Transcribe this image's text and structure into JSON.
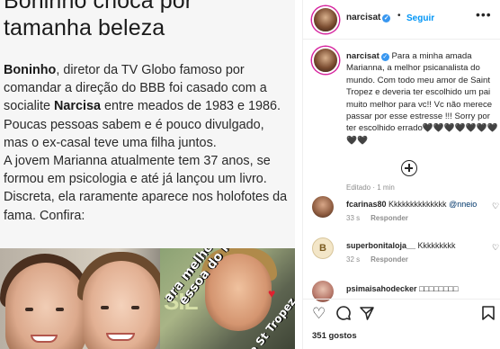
{
  "article": {
    "headline_line1": "Boninho choca por",
    "headline_line2": "tamanha beleza",
    "paragraph1": {
      "name1": "Boninho",
      "text1": ", diretor da TV Globo famoso por comandar a direção do BBB foi casado com a socialite ",
      "name2": "Narcisa",
      "text2": " entre meados de 1983 e 1986. Poucas pessoas sabem e é pouco divulgado, mas o ex-casal teve uma filha juntos."
    },
    "paragraph2": "A jovem Marianna atualmente tem 37 anos, se formou em psicologia e até já lançou um livro. Discreta, ela raramente aparece nos holofotes da fama. Confira:",
    "photo": {
      "story_word": "SIL",
      "story_text": "ara melhor filha e",
      "story_text_b": "essoa do mundo",
      "story_text_c": "e St Tropez"
    }
  },
  "post": {
    "header": {
      "username": "narcisat",
      "follow_label": "Seguir",
      "dot": "•",
      "more": "•••"
    },
    "caption": {
      "username": "narcisat",
      "text": "Para a minha amada Marianna, a melhor psicanalista do mundo. Com todo meu amor de Saint Tropez e deveria ter escolhido um pai muito melhor para vc!! Vc não merece passar por esse estresse !!! Sorry por ter escolhido errado🖤🖤🖤🖤🖤🖤🖤🖤🖤",
      "time": "Editado · 1 min"
    },
    "comments": [
      {
        "username": "fcarinas80",
        "text": "Kkkkkkkkkkkkkk",
        "mention": "@nneio",
        "time": "33 s",
        "reply": "Responder"
      },
      {
        "username": "superbonitaloja__",
        "text": "Kkkkkkkkk",
        "time": "32 s",
        "reply": "Responder"
      },
      {
        "username": "psimaisahodecker",
        "text": "□□□□□□□□",
        "time": "",
        "reply": ""
      }
    ],
    "likes": "351 gostos",
    "icons": [
      "heart-icon",
      "comment-icon",
      "share-icon",
      "save-icon"
    ]
  },
  "colors": {
    "accent_blue": "#0095f6",
    "verified_blue": "#3897f0",
    "meta_gray": "#8e8e8e"
  }
}
